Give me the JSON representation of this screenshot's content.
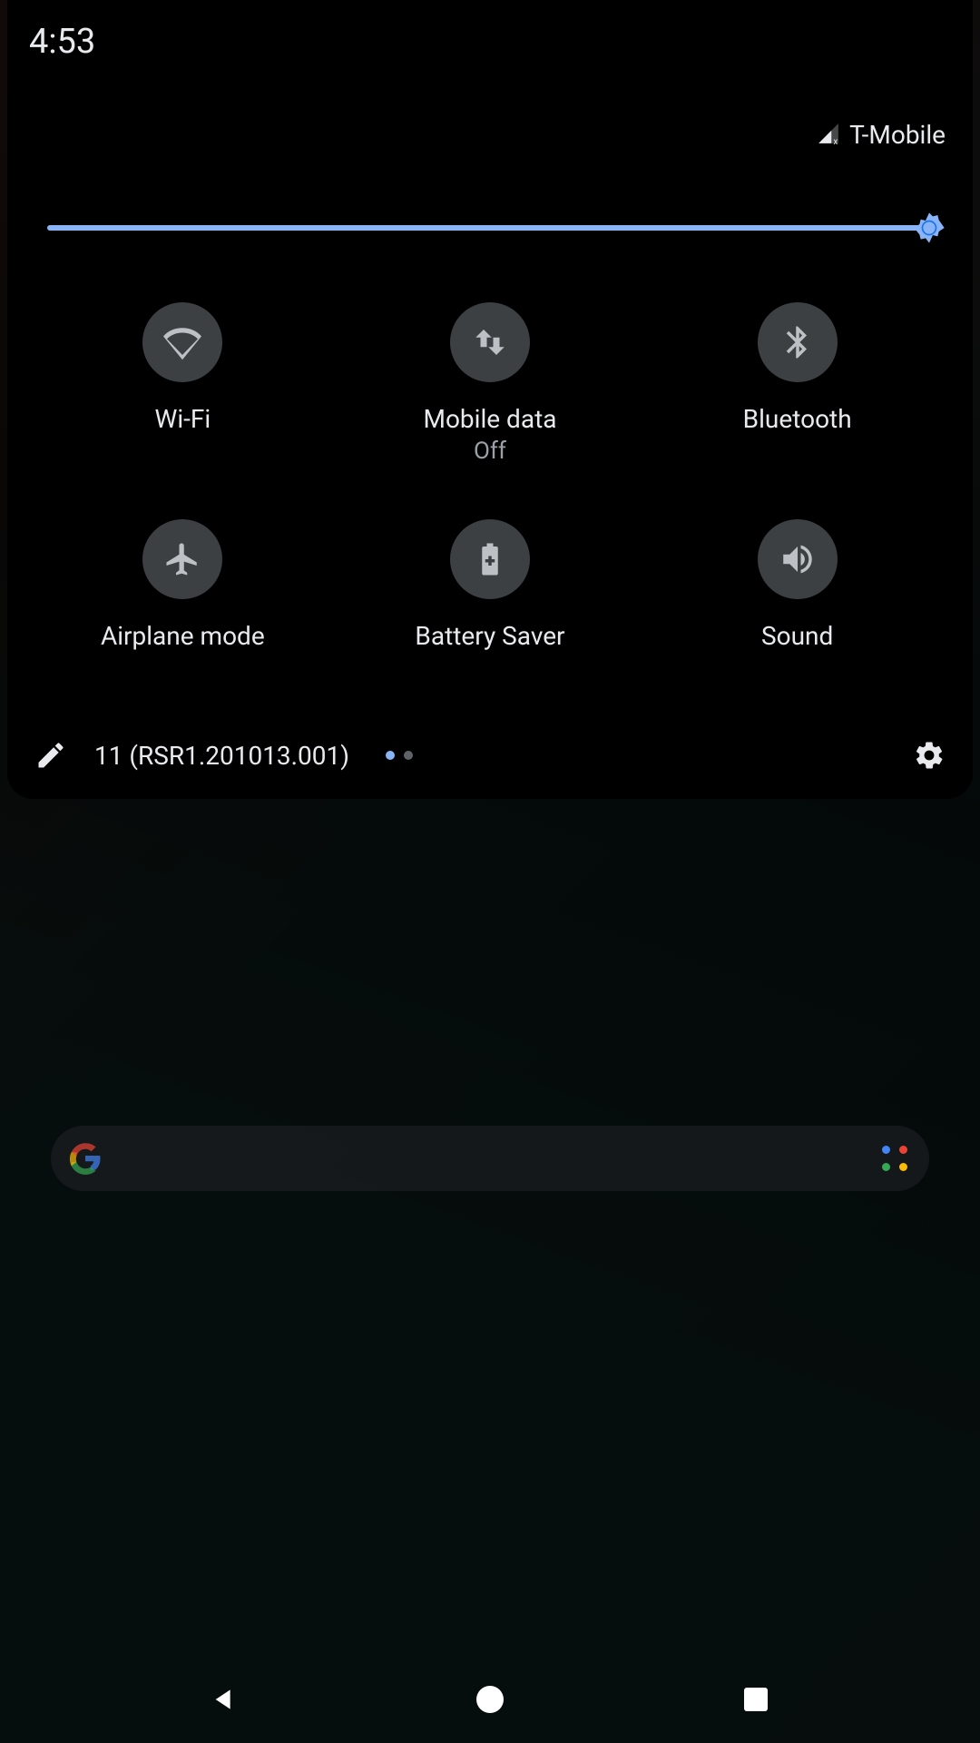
{
  "status": {
    "time": "4:53",
    "carrier": "T-Mobile"
  },
  "brightness": {
    "percent": 100
  },
  "tiles": [
    {
      "id": "wifi",
      "label": "Wi-Fi",
      "sub": ""
    },
    {
      "id": "mobiledata",
      "label": "Mobile data",
      "sub": "Off"
    },
    {
      "id": "bluetooth",
      "label": "Bluetooth",
      "sub": ""
    },
    {
      "id": "airplane",
      "label": "Airplane mode",
      "sub": ""
    },
    {
      "id": "battery",
      "label": "Battery Saver",
      "sub": ""
    },
    {
      "id": "sound",
      "label": "Sound",
      "sub": ""
    }
  ],
  "footer": {
    "build": "11 (RSR1.201013.001)",
    "page_count": 2,
    "active_page": 0
  },
  "colors": {
    "accent": "#8ab4f8",
    "tile_bg": "#3c4043",
    "icon": "#bdc1c6"
  }
}
